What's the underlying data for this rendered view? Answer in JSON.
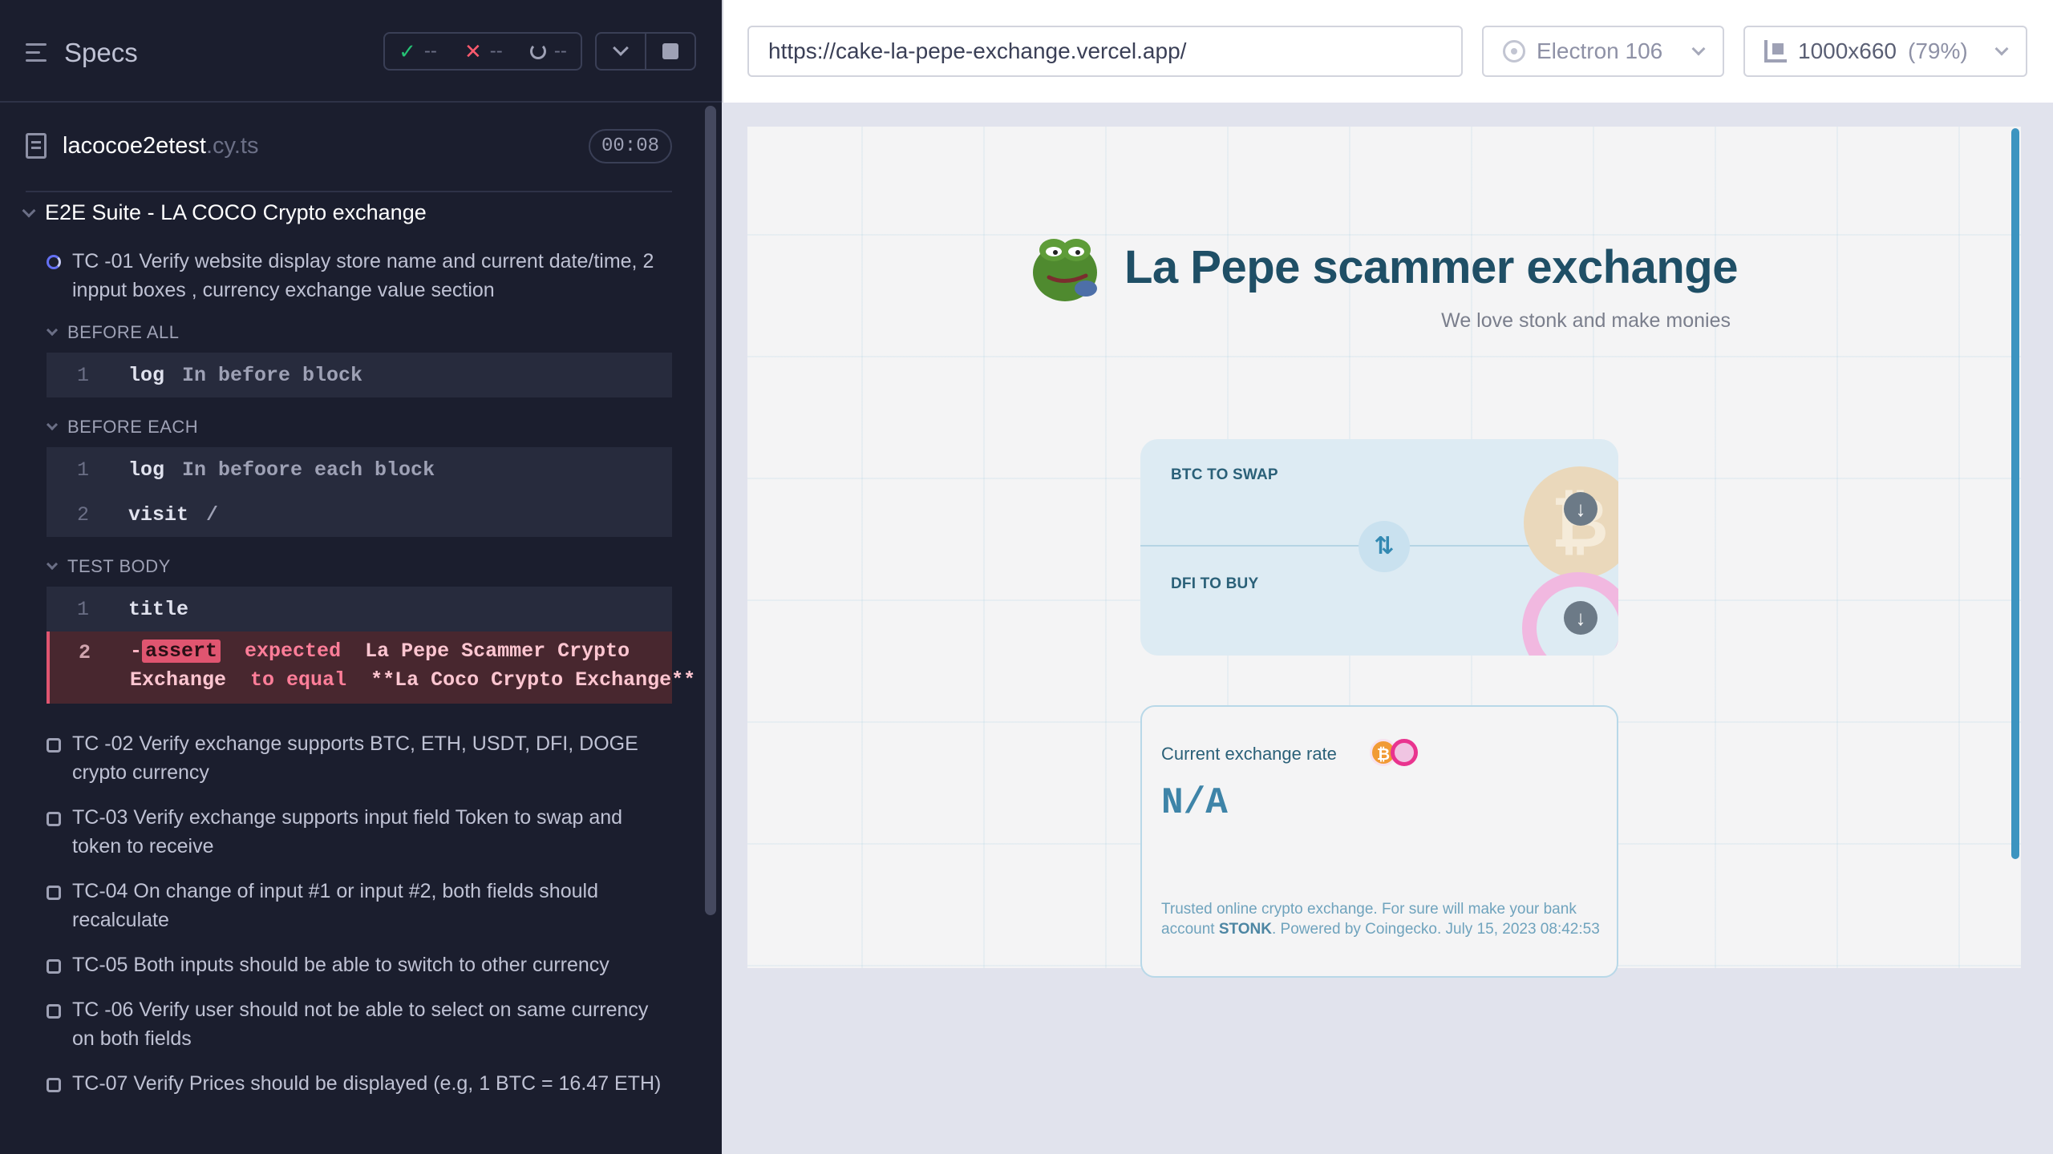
{
  "reporter": {
    "specs_title": "Specs",
    "stats": {
      "passed": "--",
      "failed": "--",
      "pending": "--"
    },
    "file": {
      "name": "lacocoe2etest",
      "ext": ".cy.ts",
      "duration": "00:08"
    },
    "suite_title": "E2E Suite - LA COCO Crypto exchange",
    "active_test": {
      "title": "TC -01 Verify website display store name and current date/time, 2 inpput boxes , currency exchange value section",
      "hooks": [
        {
          "label": "BEFORE ALL",
          "commands": [
            {
              "num": "1",
              "name": "log",
              "msg": "In before block"
            }
          ]
        },
        {
          "label": "BEFORE EACH",
          "commands": [
            {
              "num": "1",
              "name": "log",
              "msg": "In befoore each block"
            },
            {
              "num": "2",
              "name": "visit",
              "msg": "/"
            }
          ]
        },
        {
          "label": "TEST BODY",
          "commands": [
            {
              "num": "1",
              "name": "title",
              "msg": ""
            }
          ]
        }
      ],
      "failed_command": {
        "num": "2",
        "dash": "-",
        "name": "assert",
        "kw1": "expected",
        "val1a": "La Pepe Scammer Crypto",
        "val1b": "Exchange",
        "kw2": "to equal",
        "val2": "**La Coco Crypto Exchange**"
      }
    },
    "tests": [
      "TC -02 Verify exchange supports BTC, ETH, USDT, DFI, DOGE crypto currency",
      "TC-03 Verify exchange supports input field Token to swap and token to receive",
      "TC-04 On change of input #1 or input #2, both fields should recalculate",
      "TC-05 Both inputs should be able to switch to other currency",
      "TC -06 Verify user should not be able to select on same currency on both fields",
      "TC-07 Verify Prices should be displayed (e.g, 1 BTC = 16.47 ETH)"
    ]
  },
  "toolbar": {
    "url": "https://cake-la-pepe-exchange.vercel.app/",
    "browser": "Electron 106",
    "viewport": "1000x660",
    "scale": "(79%)"
  },
  "app": {
    "brand": "La Pepe scammer exchange",
    "tagline": "We love stonk and make monies",
    "swap_label": "BTC TO SWAP",
    "buy_label": "DFI TO BUY",
    "rate_label": "Current exchange rate",
    "rate_value": "N/A",
    "footer_pre": "Trusted online crypto exchange. For sure will make your bank account ",
    "footer_bold": "STONK",
    "footer_post": ". Powered by Coingecko. July 15, 2023 08:42:53"
  },
  "colors": {
    "reporter_bg": "#1b1e2e",
    "fail_bg": "#48272f",
    "brand": "#1f4f66",
    "accent": "#3c94c0"
  }
}
